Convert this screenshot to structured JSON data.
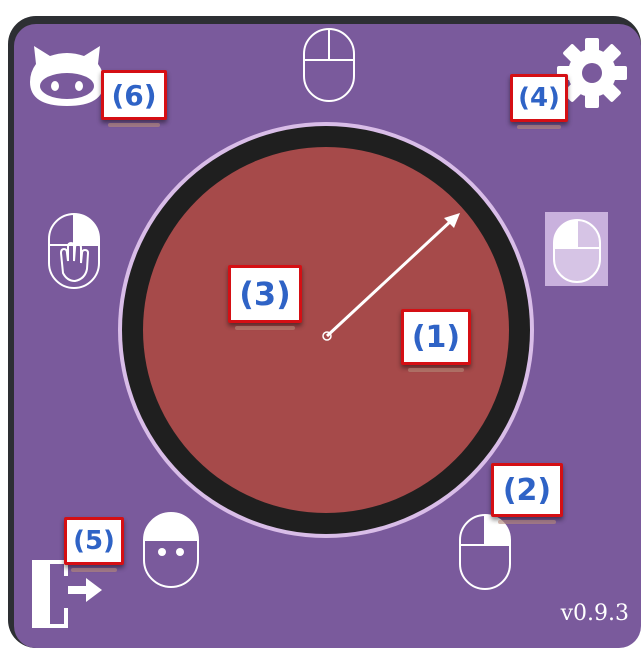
{
  "window": {
    "version": "v0.9.3"
  },
  "badges": {
    "b1": "(1)",
    "b2": "(2)",
    "b3": "(3)",
    "b4": "(4)",
    "b5": "(5)",
    "b6": "(6)"
  },
  "icons": {
    "top": "mouse-outline-icon",
    "left": "mouse-hand-grab-icon",
    "right": "mouse-left-click-icon",
    "bottom_left": "mouse-face-icon",
    "bottom_right": "mouse-right-click-icon",
    "github": "github-cat-icon",
    "settings": "gear-icon",
    "exit": "exit-door-icon"
  },
  "colors": {
    "panel": "#7a5a9c",
    "frame": "#2d2f33",
    "dial_fill": "#a64a4a",
    "dial_ring": "#1f1f1f",
    "badge_border": "#d50f14",
    "badge_text": "#2f63c6",
    "highlight": "#c9b1dd"
  }
}
